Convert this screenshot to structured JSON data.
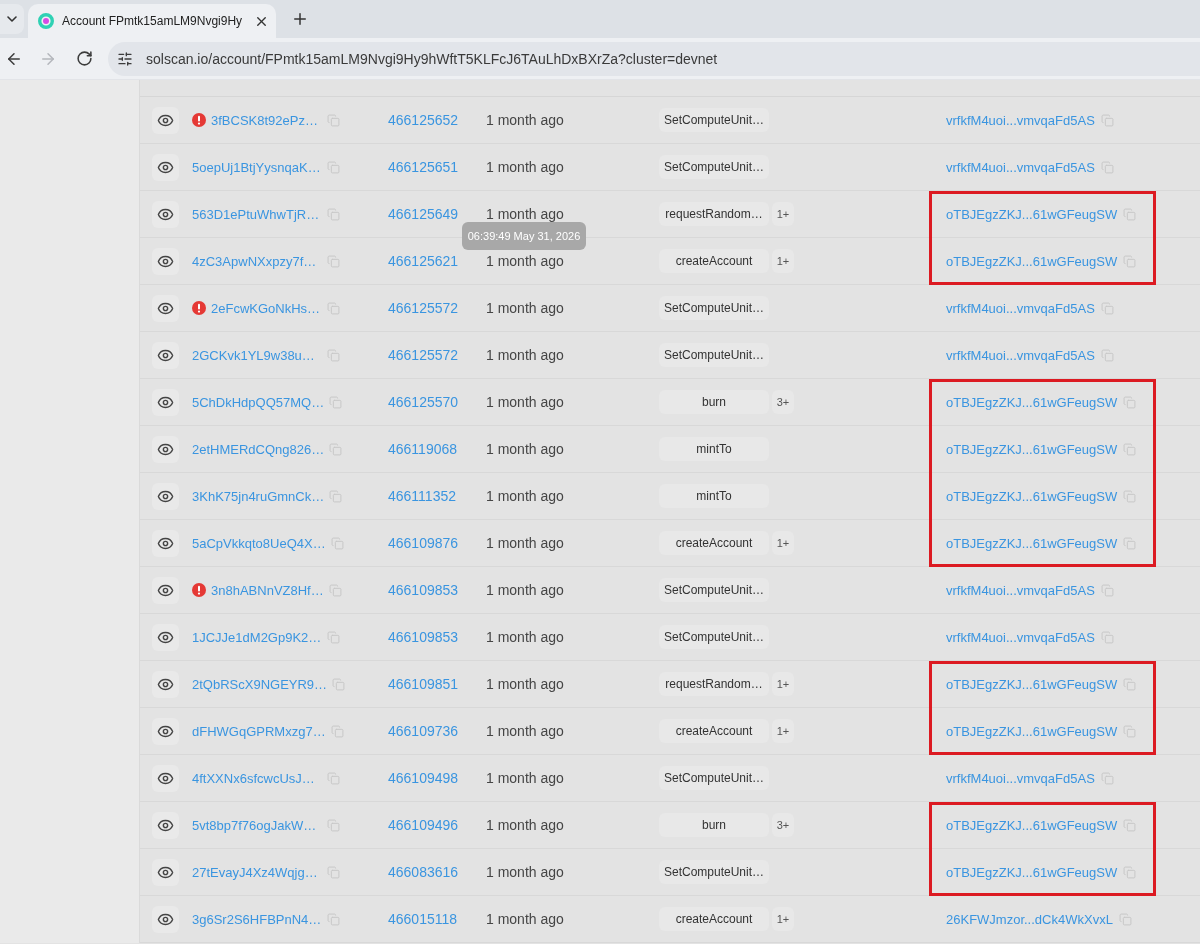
{
  "browser": {
    "tabs": [
      {
        "title": "Account FPmtk15amLM9Nvgi9Hy",
        "selected": true
      }
    ],
    "toolbar": {
      "back": {
        "disabled": false
      },
      "forward": {
        "disabled": true
      },
      "address": "solscan.io/account/FPmtk15amLM9Nvgi9Hy9hWftT5KLFcJ6TAuLhDxBXrZa?cluster=devnet"
    }
  },
  "transactions": {
    "rows": [
      {
        "signature": "3fBCSK8t92ePz…",
        "failed": true,
        "block": "466125652",
        "age": "1 month ago",
        "method": "SetComputeUnit…",
        "signer": "vrfkfM4uoi...vmvqaFd5AS",
        "highlighted": false
      },
      {
        "signature": "5oepUj1BtjYysnqaK…",
        "failed": false,
        "block": "466125651",
        "age": "1 month ago",
        "method": "SetComputeUnit…",
        "signer": "vrfkfM4uoi...vmvqaFd5AS",
        "highlighted": false
      },
      {
        "signature": "563D1ePtuWhwTjR…",
        "failed": false,
        "block": "466125649",
        "age": "1 month ago",
        "tooltip": "06:39:49 May 31, 2026",
        "method": "requestRandom…",
        "count": "1+",
        "signer": "oTBJEgzZKJ...61wGFeugSW",
        "highlighted": true
      },
      {
        "signature": "4zC3ApwNXxpzy7f…",
        "failed": false,
        "block": "466125621",
        "age": "1 month ago",
        "method": "createAccount",
        "count": "1+",
        "signer": "oTBJEgzZKJ...61wGFeugSW",
        "highlighted": true
      },
      {
        "signature": "2eFcwKGoNkHs…",
        "failed": true,
        "block": "466125572",
        "age": "1 month ago",
        "method": "SetComputeUnit…",
        "signer": "vrfkfM4uoi...vmvqaFd5AS",
        "highlighted": false
      },
      {
        "signature": "2GCKvk1YL9w38u…",
        "failed": false,
        "block": "466125572",
        "age": "1 month ago",
        "method": "SetComputeUnit…",
        "signer": "vrfkfM4uoi...vmvqaFd5AS",
        "highlighted": false
      },
      {
        "signature": "5ChDkHdpQQ57MQ…",
        "failed": false,
        "block": "466125570",
        "age": "1 month ago",
        "method": "burn",
        "count": "3+",
        "signer": "oTBJEgzZKJ...61wGFeugSW",
        "highlighted": true
      },
      {
        "signature": "2etHMERdCQng826…",
        "failed": false,
        "block": "466119068",
        "age": "1 month ago",
        "method": "mintTo",
        "signer": "oTBJEgzZKJ...61wGFeugSW",
        "highlighted": true
      },
      {
        "signature": "3KhK75jn4ruGmnCk…",
        "failed": false,
        "block": "466111352",
        "age": "1 month ago",
        "method": "mintTo",
        "signer": "oTBJEgzZKJ...61wGFeugSW",
        "highlighted": true
      },
      {
        "signature": "5aCpVkkqto8UeQ4X…",
        "failed": false,
        "block": "466109876",
        "age": "1 month ago",
        "method": "createAccount",
        "count": "1+",
        "signer": "oTBJEgzZKJ...61wGFeugSW",
        "highlighted": true
      },
      {
        "signature": "3n8hABNnVZ8Hf…",
        "failed": true,
        "block": "466109853",
        "age": "1 month ago",
        "method": "SetComputeUnit…",
        "signer": "vrfkfM4uoi...vmvqaFd5AS",
        "highlighted": false
      },
      {
        "signature": "1JCJJe1dM2Gp9K2…",
        "failed": false,
        "block": "466109853",
        "age": "1 month ago",
        "method": "SetComputeUnit…",
        "signer": "vrfkfM4uoi...vmvqaFd5AS",
        "highlighted": false
      },
      {
        "signature": "2tQbRScX9NGEYR9…",
        "failed": false,
        "block": "466109851",
        "age": "1 month ago",
        "method": "requestRandom…",
        "count": "1+",
        "signer": "oTBJEgzZKJ...61wGFeugSW",
        "highlighted": true
      },
      {
        "signature": "dFHWGqGPRMxzg7…",
        "failed": false,
        "block": "466109736",
        "age": "1 month ago",
        "method": "createAccount",
        "count": "1+",
        "signer": "oTBJEgzZKJ...61wGFeugSW",
        "highlighted": true
      },
      {
        "signature": "4ftXXNx6sfcwcUsJ…",
        "failed": false,
        "block": "466109498",
        "age": "1 month ago",
        "method": "SetComputeUnit…",
        "signer": "vrfkfM4uoi...vmvqaFd5AS",
        "highlighted": false
      },
      {
        "signature": "5vt8bp7f76ogJakW…",
        "failed": false,
        "block": "466109496",
        "age": "1 month ago",
        "method": "burn",
        "count": "3+",
        "signer": "oTBJEgzZKJ...61wGFeugSW",
        "highlighted": true
      },
      {
        "signature": "27tEvayJ4Xz4Wqjg…",
        "failed": false,
        "block": "466083616",
        "age": "1 month ago",
        "method": "SetComputeUnit…",
        "signer": "oTBJEgzZKJ...61wGFeugSW",
        "highlighted": true
      },
      {
        "signature": "3g6Sr2S6HFBPnN4…",
        "failed": false,
        "block": "466015118",
        "age": "1 month ago",
        "method": "createAccount",
        "count": "1+",
        "signer": "26KFWJmzor...dCk4WkXvxL",
        "highlighted": false
      }
    ]
  }
}
